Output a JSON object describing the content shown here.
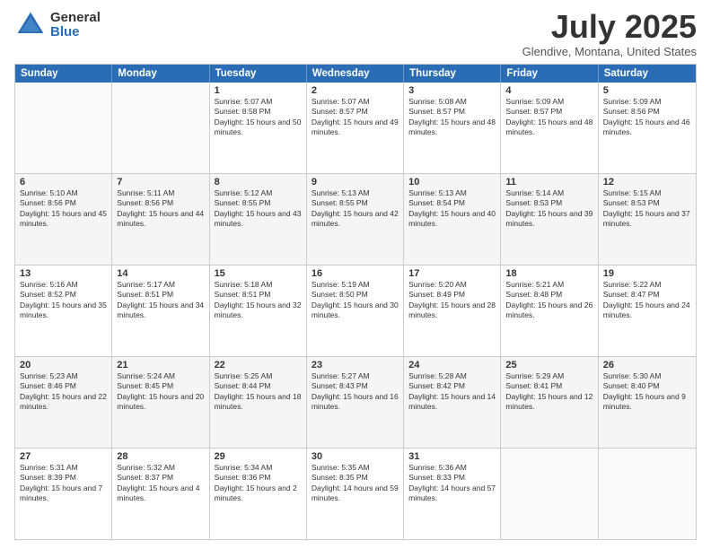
{
  "logo": {
    "general": "General",
    "blue": "Blue"
  },
  "title": "July 2025",
  "location": "Glendive, Montana, United States",
  "weekdays": [
    "Sunday",
    "Monday",
    "Tuesday",
    "Wednesday",
    "Thursday",
    "Friday",
    "Saturday"
  ],
  "weeks": [
    [
      {
        "day": "",
        "empty": true
      },
      {
        "day": "",
        "empty": true
      },
      {
        "day": "1",
        "sunrise": "5:07 AM",
        "sunset": "8:58 PM",
        "daylight": "15 hours and 50 minutes."
      },
      {
        "day": "2",
        "sunrise": "5:07 AM",
        "sunset": "8:57 PM",
        "daylight": "15 hours and 49 minutes."
      },
      {
        "day": "3",
        "sunrise": "5:08 AM",
        "sunset": "8:57 PM",
        "daylight": "15 hours and 48 minutes."
      },
      {
        "day": "4",
        "sunrise": "5:09 AM",
        "sunset": "8:57 PM",
        "daylight": "15 hours and 48 minutes."
      },
      {
        "day": "5",
        "sunrise": "5:09 AM",
        "sunset": "8:56 PM",
        "daylight": "15 hours and 46 minutes."
      }
    ],
    [
      {
        "day": "6",
        "sunrise": "5:10 AM",
        "sunset": "8:56 PM",
        "daylight": "15 hours and 45 minutes."
      },
      {
        "day": "7",
        "sunrise": "5:11 AM",
        "sunset": "8:56 PM",
        "daylight": "15 hours and 44 minutes."
      },
      {
        "day": "8",
        "sunrise": "5:12 AM",
        "sunset": "8:55 PM",
        "daylight": "15 hours and 43 minutes."
      },
      {
        "day": "9",
        "sunrise": "5:13 AM",
        "sunset": "8:55 PM",
        "daylight": "15 hours and 42 minutes."
      },
      {
        "day": "10",
        "sunrise": "5:13 AM",
        "sunset": "8:54 PM",
        "daylight": "15 hours and 40 minutes."
      },
      {
        "day": "11",
        "sunrise": "5:14 AM",
        "sunset": "8:53 PM",
        "daylight": "15 hours and 39 minutes."
      },
      {
        "day": "12",
        "sunrise": "5:15 AM",
        "sunset": "8:53 PM",
        "daylight": "15 hours and 37 minutes."
      }
    ],
    [
      {
        "day": "13",
        "sunrise": "5:16 AM",
        "sunset": "8:52 PM",
        "daylight": "15 hours and 35 minutes."
      },
      {
        "day": "14",
        "sunrise": "5:17 AM",
        "sunset": "8:51 PM",
        "daylight": "15 hours and 34 minutes."
      },
      {
        "day": "15",
        "sunrise": "5:18 AM",
        "sunset": "8:51 PM",
        "daylight": "15 hours and 32 minutes."
      },
      {
        "day": "16",
        "sunrise": "5:19 AM",
        "sunset": "8:50 PM",
        "daylight": "15 hours and 30 minutes."
      },
      {
        "day": "17",
        "sunrise": "5:20 AM",
        "sunset": "8:49 PM",
        "daylight": "15 hours and 28 minutes."
      },
      {
        "day": "18",
        "sunrise": "5:21 AM",
        "sunset": "8:48 PM",
        "daylight": "15 hours and 26 minutes."
      },
      {
        "day": "19",
        "sunrise": "5:22 AM",
        "sunset": "8:47 PM",
        "daylight": "15 hours and 24 minutes."
      }
    ],
    [
      {
        "day": "20",
        "sunrise": "5:23 AM",
        "sunset": "8:46 PM",
        "daylight": "15 hours and 22 minutes."
      },
      {
        "day": "21",
        "sunrise": "5:24 AM",
        "sunset": "8:45 PM",
        "daylight": "15 hours and 20 minutes."
      },
      {
        "day": "22",
        "sunrise": "5:25 AM",
        "sunset": "8:44 PM",
        "daylight": "15 hours and 18 minutes."
      },
      {
        "day": "23",
        "sunrise": "5:27 AM",
        "sunset": "8:43 PM",
        "daylight": "15 hours and 16 minutes."
      },
      {
        "day": "24",
        "sunrise": "5:28 AM",
        "sunset": "8:42 PM",
        "daylight": "15 hours and 14 minutes."
      },
      {
        "day": "25",
        "sunrise": "5:29 AM",
        "sunset": "8:41 PM",
        "daylight": "15 hours and 12 minutes."
      },
      {
        "day": "26",
        "sunrise": "5:30 AM",
        "sunset": "8:40 PM",
        "daylight": "15 hours and 9 minutes."
      }
    ],
    [
      {
        "day": "27",
        "sunrise": "5:31 AM",
        "sunset": "8:39 PM",
        "daylight": "15 hours and 7 minutes."
      },
      {
        "day": "28",
        "sunrise": "5:32 AM",
        "sunset": "8:37 PM",
        "daylight": "15 hours and 4 minutes."
      },
      {
        "day": "29",
        "sunrise": "5:34 AM",
        "sunset": "8:36 PM",
        "daylight": "15 hours and 2 minutes."
      },
      {
        "day": "30",
        "sunrise": "5:35 AM",
        "sunset": "8:35 PM",
        "daylight": "14 hours and 59 minutes."
      },
      {
        "day": "31",
        "sunrise": "5:36 AM",
        "sunset": "8:33 PM",
        "daylight": "14 hours and 57 minutes."
      },
      {
        "day": "",
        "empty": true
      },
      {
        "day": "",
        "empty": true
      }
    ]
  ]
}
